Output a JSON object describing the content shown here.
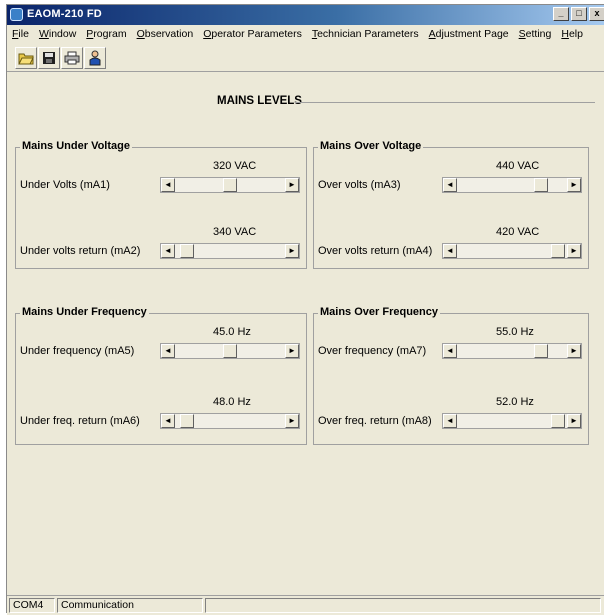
{
  "window": {
    "title": "EAOM-210 FD",
    "minimize_glyph": "_",
    "maximize_glyph": "□",
    "close_glyph": "x"
  },
  "menu": [
    {
      "underline": "F",
      "rest": "ile"
    },
    {
      "underline": "W",
      "rest": "indow"
    },
    {
      "underline": "P",
      "rest": "rogram"
    },
    {
      "underline": "O",
      "rest": "bservation"
    },
    {
      "underline": "O",
      "rest": "perator Parameters"
    },
    {
      "underline": "T",
      "rest": "echnician Parameters"
    },
    {
      "underline": "A",
      "rest": "djustment Page"
    },
    {
      "underline": "S",
      "rest": "etting"
    },
    {
      "underline": "H",
      "rest": "elp"
    }
  ],
  "toolbar": {
    "icons": [
      "open-folder-icon",
      "save-disk-icon",
      "print-icon",
      "user-icon"
    ]
  },
  "page": {
    "heading": "MAINS LEVELS"
  },
  "groups": {
    "under_voltage": {
      "title": "Mains Under Voltage",
      "rows": [
        {
          "label": "Under Volts (mA1)",
          "value": "320 VAC",
          "level": 0.5
        },
        {
          "label": "Under volts return (mA2)",
          "value": "340 VAC",
          "level": 0.05
        }
      ]
    },
    "over_voltage": {
      "title": "Mains Over Voltage",
      "rows": [
        {
          "label": "Over volts (mA3)",
          "value": "440 VAC",
          "level": 0.8
        },
        {
          "label": "Over volts return (mA4)",
          "value": "420 VAC",
          "level": 0.98
        }
      ]
    },
    "under_frequency": {
      "title": "Mains Under Frequency",
      "rows": [
        {
          "label": "Under frequency (mA5)",
          "value": "45.0 Hz",
          "level": 0.5
        },
        {
          "label": "Under freq. return (mA6)",
          "value": "48.0 Hz",
          "level": 0.05
        }
      ]
    },
    "over_frequency": {
      "title": "Mains Over Frequency",
      "rows": [
        {
          "label": "Over frequency (mA7)",
          "value": "55.0 Hz",
          "level": 0.8
        },
        {
          "label": "Over freq. return (mA8)",
          "value": "52.0 Hz",
          "level": 0.98
        }
      ]
    }
  },
  "status": {
    "port": "COM4",
    "state": "Communication"
  }
}
